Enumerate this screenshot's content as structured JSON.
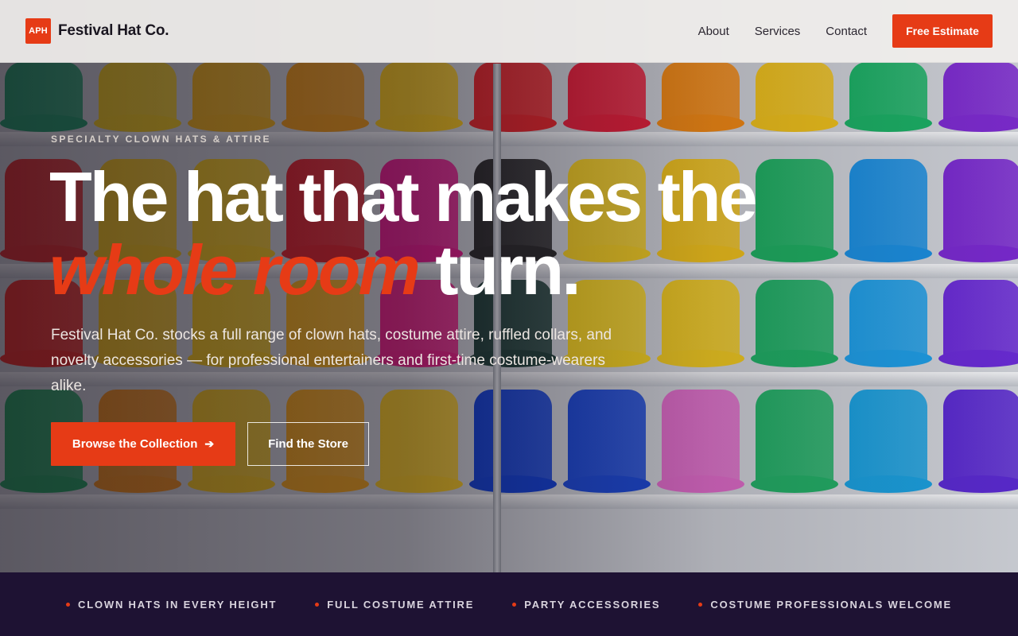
{
  "brand": {
    "badge": "APH",
    "name": "Festival Hat Co.",
    "accent_color": "#e63b16"
  },
  "nav": {
    "links": [
      "About",
      "Services",
      "Contact"
    ],
    "cta": "Free Estimate"
  },
  "hero": {
    "eyebrow": "SPECIALTY CLOWN HATS & ATTIRE",
    "headline_line1": "The hat that makes the",
    "headline_accent": "whole room",
    "headline_end": "turn.",
    "lede": "Festival Hat Co. stocks a full range of clown hats, costume attire, ruffled collars, and novelty accessories — for professional entertainers and first-time costume-wearers alike.",
    "primary_button": "Browse the Collection",
    "primary_button_icon": "arrow-right-icon",
    "secondary_button": "Find the Store"
  },
  "features": [
    "CLOWN HATS IN EVERY HEIGHT",
    "FULL COSTUME ATTIRE",
    "PARTY ACCESSORIES",
    "COSTUME PROFESSIONALS WELCOME"
  ]
}
